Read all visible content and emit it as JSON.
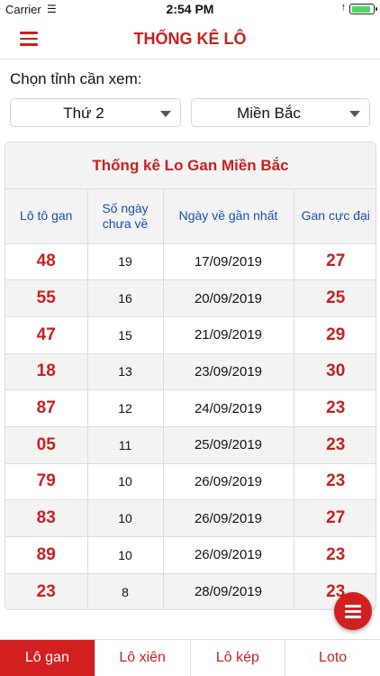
{
  "status_bar": {
    "carrier": "Carrier",
    "time": "2:54 PM",
    "battery_level": 0.95
  },
  "header": {
    "title": "THỐNG KÊ LÔ",
    "menu_icon": "hamburger-icon"
  },
  "filters": {
    "label": "Chọn tỉnh cần xem:",
    "day_value": "Thứ 2",
    "region_value": "Miền Bắc"
  },
  "card": {
    "title": "Thống kê Lo Gan Miền Bắc",
    "columns": [
      "Lô tô gan",
      "Số ngày chưa về",
      "Ngày về gần nhất",
      "Gan cực đại"
    ],
    "rows": [
      {
        "lo": "48",
        "days": "19",
        "date": "17/09/2019",
        "max": "27"
      },
      {
        "lo": "55",
        "days": "16",
        "date": "20/09/2019",
        "max": "25"
      },
      {
        "lo": "47",
        "days": "15",
        "date": "21/09/2019",
        "max": "29"
      },
      {
        "lo": "18",
        "days": "13",
        "date": "23/09/2019",
        "max": "30"
      },
      {
        "lo": "87",
        "days": "12",
        "date": "24/09/2019",
        "max": "23"
      },
      {
        "lo": "05",
        "days": "11",
        "date": "25/09/2019",
        "max": "23"
      },
      {
        "lo": "79",
        "days": "10",
        "date": "26/09/2019",
        "max": "23"
      },
      {
        "lo": "83",
        "days": "10",
        "date": "26/09/2019",
        "max": "27"
      },
      {
        "lo": "89",
        "days": "10",
        "date": "26/09/2019",
        "max": "23"
      },
      {
        "lo": "23",
        "days": "8",
        "date": "28/09/2019",
        "max": "23"
      }
    ]
  },
  "tabs": [
    {
      "label": "Lô gan",
      "active": true
    },
    {
      "label": "Lô xiên",
      "active": false
    },
    {
      "label": "Lô kép",
      "active": false
    },
    {
      "label": "Loto",
      "active": false
    }
  ],
  "colors": {
    "accent": "#c8201e",
    "header_text": "#1a4fa8",
    "row_alt": "#f3f3f3"
  }
}
